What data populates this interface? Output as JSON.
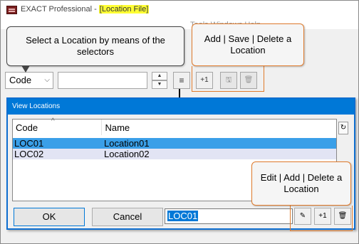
{
  "titlebar": {
    "app_name": "EXACT Professional -",
    "file_label": "[Location File]"
  },
  "menu": {
    "partial_text": "Tools  Windows  Help"
  },
  "callouts": {
    "select": "Select a Location by means of the selectors",
    "add_save": "Add | Save | Delete a Location",
    "edit": "Edit | Add | Delete a Location"
  },
  "toolbar": {
    "combo_value": "Code",
    "combo_arrow": "⌵",
    "search_value": "",
    "spin_up": "▲",
    "spin_down": "▼",
    "filter_glyph": "≡",
    "add_label": "+1",
    "save_glyph": "🖫",
    "delete_glyph": "🗑"
  },
  "dialog": {
    "title": "View Locations",
    "columns": [
      "Code",
      "Name"
    ],
    "rows": [
      {
        "code": "LOC01",
        "name": "Location01"
      },
      {
        "code": "LOC02",
        "name": "Location02"
      }
    ],
    "ok_label": "OK",
    "cancel_label": "Cancel",
    "code_value": "LOC01",
    "edit_glyph": "✎",
    "add_label": "+1",
    "delete_glyph": "🗑",
    "refresh_glyph": "↻"
  },
  "colors": {
    "highlight": "#ffff33",
    "accent": "#e07b2c",
    "selection": "#3a9fe8",
    "dialog_title": "#0078d7"
  }
}
